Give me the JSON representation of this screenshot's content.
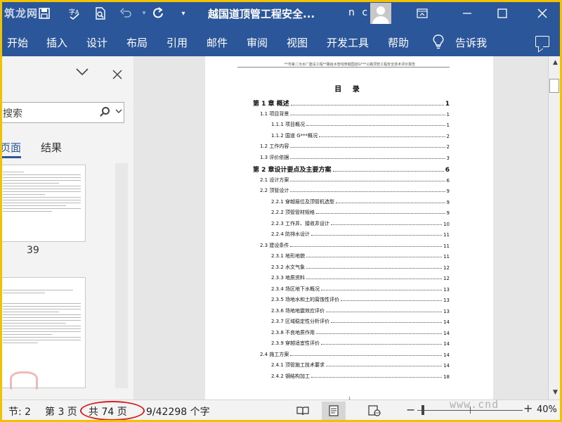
{
  "titlebar": {
    "logo_text": "筑龙网",
    "title": "越国道顶管工程安全...",
    "user": "n c",
    "colors": {
      "accent": "#2b579a"
    }
  },
  "ribbon": {
    "tabs": [
      "开始",
      "插入",
      "设计",
      "布局",
      "引用",
      "邮件",
      "审阅",
      "视图",
      "开发工具",
      "帮助"
    ],
    "tell_me": "告诉我"
  },
  "nav": {
    "search_placeholder": "搜索",
    "tab_pages": "页面",
    "tab_results": "结果",
    "thumb_page_number": "39"
  },
  "document": {
    "header_text": "**市第二污水厂建设工程**路给水管线穿越国道G***公路顶管工程安全技术评价报告",
    "toc_title": "目  录",
    "toc": [
      {
        "level": 0,
        "text": "第 1 章  概述",
        "page": "1"
      },
      {
        "level": 1,
        "text": "1.1  项目背景",
        "page": "1"
      },
      {
        "level": 2,
        "text": "1.1.1  项目概况",
        "page": "1"
      },
      {
        "level": 2,
        "text": "1.1.2  国道 G***概况",
        "page": "2"
      },
      {
        "level": 1,
        "text": "1.2  工作内容",
        "page": "2"
      },
      {
        "level": 1,
        "text": "1.3  评价依据",
        "page": "3"
      },
      {
        "level": 0,
        "text": "第 2 章设计要点及主要方案",
        "page": "6"
      },
      {
        "level": 1,
        "text": "2.1  设计方案",
        "page": "6"
      },
      {
        "level": 1,
        "text": "2.2  顶管设计",
        "page": "9"
      },
      {
        "level": 2,
        "text": "2.2.1  穿越层位及顶管机选型",
        "page": "9"
      },
      {
        "level": 2,
        "text": "2.2.2  顶管管材规格",
        "page": "9"
      },
      {
        "level": 2,
        "text": "2.2.3  工作井、接收井设计",
        "page": "10"
      },
      {
        "level": 2,
        "text": "2.2.4  防排水设计",
        "page": "11"
      },
      {
        "level": 1,
        "text": "2.3  建设条件",
        "page": "11"
      },
      {
        "level": 2,
        "text": "2.3.1  地形地貌",
        "page": "11"
      },
      {
        "level": 2,
        "text": "2.3.2  水文气象",
        "page": "12"
      },
      {
        "level": 2,
        "text": "2.3.3  地质资料",
        "page": "12"
      },
      {
        "level": 2,
        "text": "2.3.4  场区地下水概况",
        "page": "13"
      },
      {
        "level": 2,
        "text": "2.3.5  场地水和土的腐蚀性评价",
        "page": "13"
      },
      {
        "level": 2,
        "text": "2.3.6  场地地震效应评价",
        "page": "13"
      },
      {
        "level": 2,
        "text": "2.3.7  区域稳定性分析评价",
        "page": "14"
      },
      {
        "level": 2,
        "text": "2.3.8  不良地质作用",
        "page": "14"
      },
      {
        "level": 2,
        "text": "2.3.9  穿越适宜性评价",
        "page": "14"
      },
      {
        "level": 1,
        "text": "2.4  施工方案",
        "page": "14"
      },
      {
        "level": 2,
        "text": "2.4.1  顶管施工技术要求",
        "page": "14"
      },
      {
        "level": 2,
        "text": "2.4.2  钢结构加工",
        "page": "18"
      }
    ],
    "footer_page": "1"
  },
  "status": {
    "section": "节: 2",
    "page": "第 3 页",
    "total_pages": "共 74 页",
    "words": "9/42298 个字",
    "zoom": "40%",
    "watermark": "www.cnd",
    "colors": {
      "highlight": "#d42020"
    }
  }
}
